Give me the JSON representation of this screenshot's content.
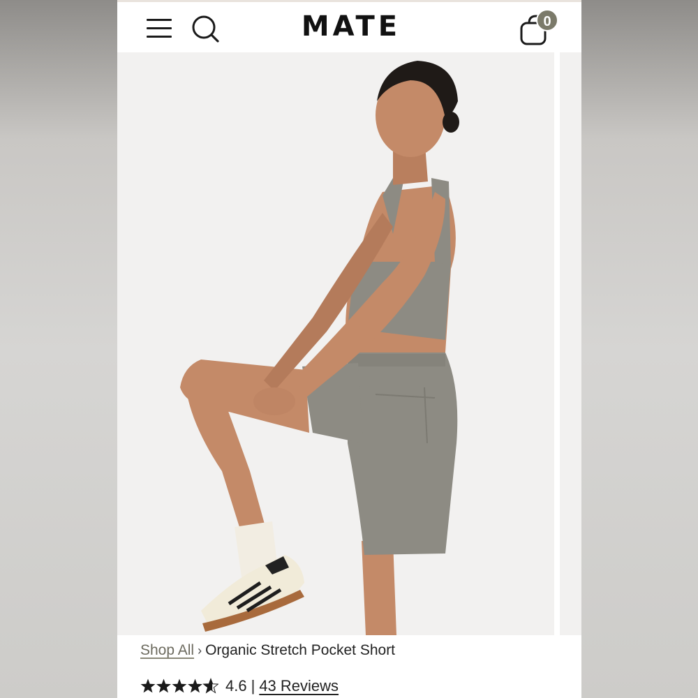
{
  "header": {
    "logo": "MATE",
    "menu_icon": "hamburger-menu-icon",
    "search_icon": "search-icon",
    "bag_icon": "shopping-bag-icon",
    "bag_count": "0",
    "badge_color": "#7b7a6a"
  },
  "gallery": {
    "image_count_visible": 2,
    "background": "#f2f1f0",
    "product_color": "#8d8b83"
  },
  "breadcrumb": {
    "shop_all": "Shop All",
    "separator": "›",
    "current": "Organic Stretch Pocket Short"
  },
  "rating": {
    "stars_value": 4.6,
    "value_text": "4.6",
    "divider": "|",
    "reviews": "43 Reviews"
  }
}
